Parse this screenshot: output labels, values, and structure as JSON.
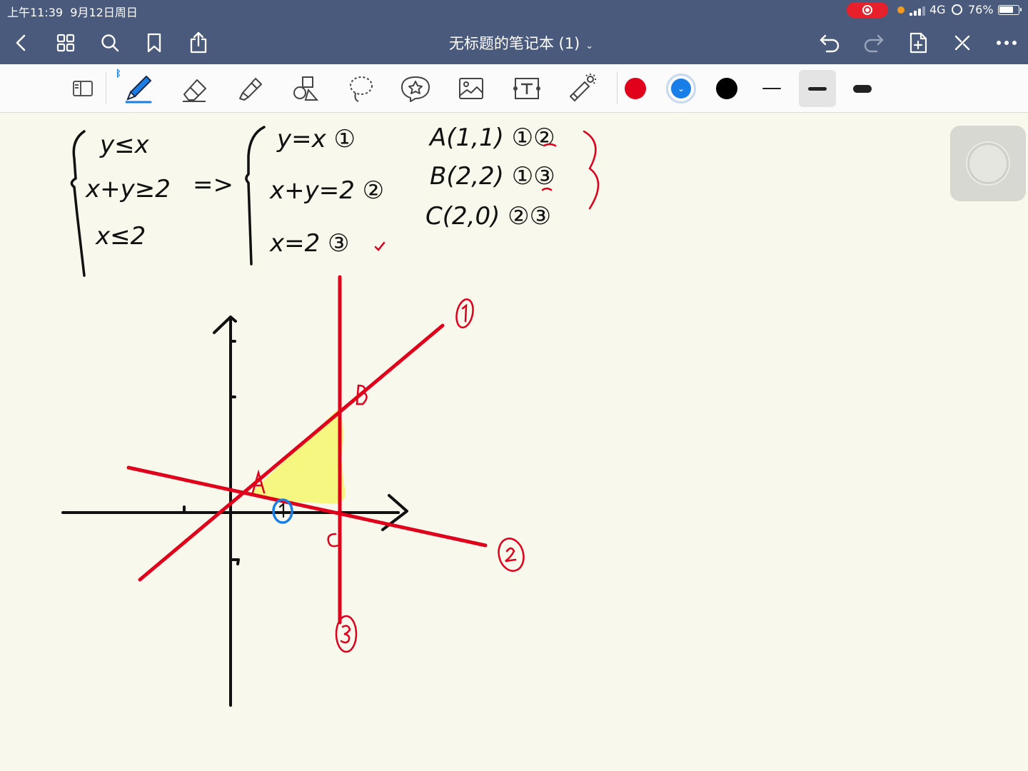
{
  "status_bar": {
    "time": "上午11:39",
    "date": "9月12日周日",
    "network": "4G",
    "battery_percent": "76%",
    "battery_level": 0.76,
    "record_color": "#e8202b"
  },
  "nav": {
    "title": "无标题的笔记本 (1)",
    "left_icons": [
      "back-icon",
      "grid-icon",
      "search-icon",
      "bookmark-icon",
      "share-icon"
    ],
    "right_icons": [
      "undo-icon",
      "redo-icon",
      "add-page-icon",
      "close-toolbar-icon",
      "more-icon"
    ]
  },
  "toolbar": {
    "tools": [
      "read-mode-icon",
      "pen-icon",
      "eraser-icon",
      "highlighter-icon",
      "shapes-icon",
      "lasso-icon",
      "sticker-icon",
      "image-icon",
      "text-icon",
      "laser-pointer-icon"
    ],
    "selected_tool": "pen-icon",
    "colors": [
      "#e0001b",
      "#1a7ee8",
      "#000000"
    ],
    "selected_color": "#1a7ee8",
    "stroke_widths": [
      "thin",
      "medium",
      "thick"
    ],
    "selected_width": "medium"
  },
  "note": {
    "system_left": [
      "y≤x",
      "x+y≥2",
      "x≤2"
    ],
    "implies": "=>",
    "system_right": [
      "y=x ①",
      "x+y=2 ②",
      "x=2 ③"
    ],
    "points": [
      "A(1,1) ①②",
      "B(2,2) ①③",
      "C(2,0) ②③"
    ],
    "line_labels": [
      "①",
      "②",
      "③"
    ],
    "vertex_labels": [
      "A",
      "B",
      "C"
    ]
  },
  "colors": {
    "ink_black": "#111111",
    "ink_red": "#e0001b",
    "ink_blue": "#1a7ee8",
    "highlight_yellow": "#f6f77a",
    "paper": "#f8f8ec",
    "bar": "#4a5a7c"
  }
}
